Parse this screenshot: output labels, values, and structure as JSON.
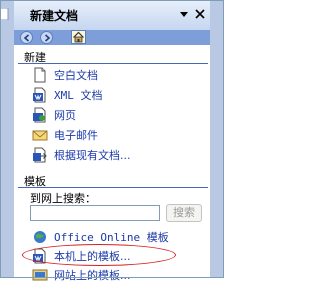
{
  "panel": {
    "title": "新建文档"
  },
  "nav": {
    "back_icon": "back-arrow-icon",
    "forward_icon": "forward-arrow-icon",
    "home_icon": "home-icon"
  },
  "sections": {
    "new": {
      "header": "新建",
      "items": [
        {
          "label": "空白文档",
          "icon": "blank-document-icon"
        },
        {
          "label": "XML 文档",
          "icon": "xml-document-icon"
        },
        {
          "label": "网页",
          "icon": "web-page-icon"
        },
        {
          "label": "电子邮件",
          "icon": "email-icon"
        },
        {
          "label": "根据现有文档...",
          "icon": "existing-document-icon"
        }
      ]
    },
    "templates": {
      "header": "模板",
      "search_label": "到网上搜索：",
      "search_button": "搜索",
      "items": [
        {
          "label": "Office Online 模板",
          "icon": "office-online-icon"
        },
        {
          "label": "本机上的模板...",
          "icon": "local-template-icon"
        },
        {
          "label": "网站上的模板...",
          "icon": "web-template-icon"
        }
      ]
    }
  },
  "colors": {
    "link": "#1b3aa8",
    "header_rule": "#4b67b0",
    "highlight": "#d42020"
  }
}
